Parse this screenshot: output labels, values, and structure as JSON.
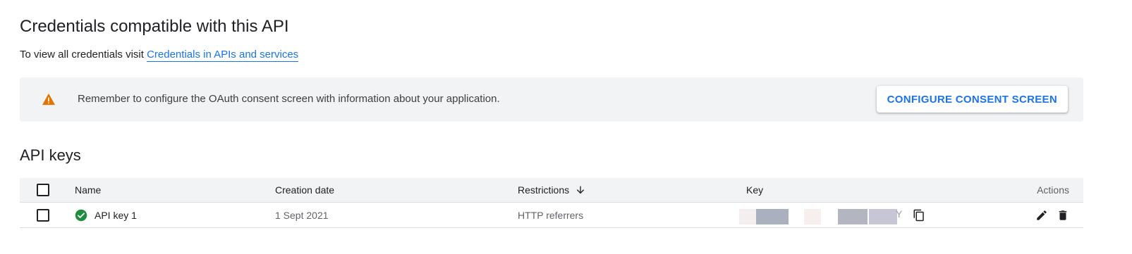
{
  "header": {
    "title": "Credentials compatible with this API",
    "subtitle_prefix": "To view all credentials visit",
    "credentials_link": "Credentials in APIs and services"
  },
  "banner": {
    "icon": "warning-icon",
    "message": "Remember to configure the OAuth consent screen with information about your application.",
    "button_label": "CONFIGURE CONSENT SCREEN"
  },
  "api_keys": {
    "section_title": "API keys",
    "columns": {
      "name": "Name",
      "creation_date": "Creation date",
      "restrictions": "Restrictions",
      "key": "Key",
      "actions": "Actions"
    },
    "sort_icon": "arrow-down-icon",
    "rows": [
      {
        "name": "API key 1",
        "status_icon": "check-circle-icon",
        "creation_date": "1 Sept 2021",
        "restrictions": "HTTP referrers",
        "key_visible_suffix": "Y"
      }
    ]
  },
  "colors": {
    "accent": "#1a73e8",
    "warning": "#e37400",
    "success": "#1e8e3e",
    "banner_bg": "#f1f3f4"
  }
}
